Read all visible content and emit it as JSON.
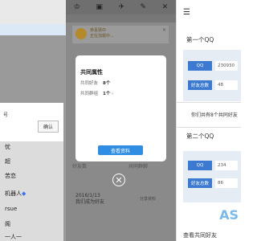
{
  "panel1": {
    "dialog_text": "号",
    "confirm_label": "确认",
    "items": [
      "‪‫ 忧",
      "超",
      "苦恋",
      "机器人",
      "rsue",
      "阁",
      "一人一"
    ]
  },
  "panel2": {
    "toolbar_icons": [
      "trophy-icon",
      "gift-icon",
      "rocket-icon",
      "chat-icon",
      "x-icon"
    ],
    "ad": {
      "title": "恭喜猜中",
      "subtitle": "正在加载中..."
    },
    "dialog": {
      "title": "共同属性",
      "rows": [
        {
          "label": "共同好友",
          "value": "8个"
        },
        {
          "label": "共同群组",
          "value": "1个"
        }
      ],
      "button": "查看资料"
    },
    "bottom_labels": [
      "好友数",
      "共同群聊"
    ],
    "date_line1": "2016/1/13",
    "date_line2": "我们成为好友",
    "share": "分享资料"
  },
  "panel3": {
    "first_title": "第一个QQ",
    "first_qq_label": "QQ",
    "first_qq_value": "230930",
    "first_count_label": "好友总数",
    "first_count_value": "48",
    "common_text": "你们共有8个共同好友",
    "second_title": "第二个QQ",
    "second_qq_label": "QQ",
    "second_qq_value": "234",
    "second_count_label": "好友总数",
    "second_count_value": "86",
    "view_common": "查看共同好友",
    "watermark": "AS"
  }
}
